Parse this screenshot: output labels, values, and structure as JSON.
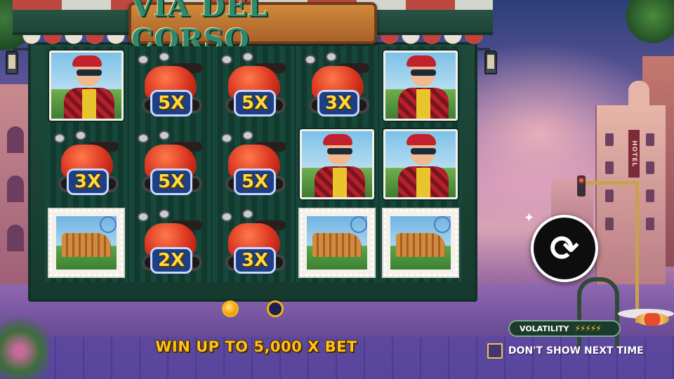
{
  "game": {
    "title": "VIA DEL CORSO"
  },
  "reels": {
    "columns": [
      [
        {
          "symbol": "traveler"
        },
        {
          "symbol": "scooter",
          "multiplier": "3X"
        },
        {
          "symbol": "colosseum-stamp"
        }
      ],
      [
        {
          "symbol": "scooter",
          "multiplier": "5X"
        },
        {
          "symbol": "scooter",
          "multiplier": "5X"
        },
        {
          "symbol": "scooter",
          "multiplier": "2X"
        }
      ],
      [
        {
          "symbol": "scooter",
          "multiplier": "5X"
        },
        {
          "symbol": "scooter",
          "multiplier": "5X"
        },
        {
          "symbol": "scooter",
          "multiplier": "3X"
        }
      ],
      [
        {
          "symbol": "scooter",
          "multiplier": "3X"
        },
        {
          "symbol": "traveler"
        },
        {
          "symbol": "colosseum-stamp"
        }
      ],
      [
        {
          "symbol": "traveler"
        },
        {
          "symbol": "traveler"
        },
        {
          "symbol": "colosseum-stamp"
        }
      ]
    ]
  },
  "pager": {
    "pages": 2,
    "active_page": 1
  },
  "promo": {
    "win_text": "WIN UP TO 5,000 X BET"
  },
  "refresh_button": {
    "icon": "refresh-icon",
    "glyph": "⟳"
  },
  "volatility": {
    "label": "VOLATILITY",
    "bolts": "⚡⚡⚡⚡⚡",
    "level": 5,
    "max": 5
  },
  "dont_show": {
    "label": "DON'T SHOW NEXT TIME",
    "checked": false
  },
  "colors": {
    "accent_gold": "#ffc21a",
    "frame_green": "#1f4a3b",
    "multiplier_blue": "#1e3f86"
  }
}
